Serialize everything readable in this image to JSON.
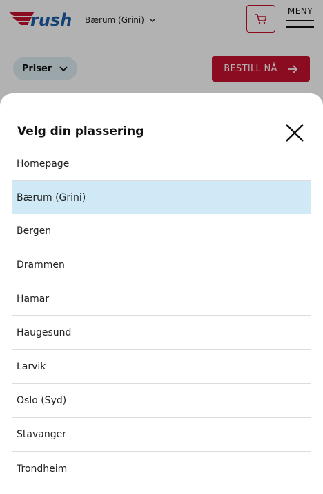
{
  "header": {
    "logo_text": "rush",
    "current_location": "Bærum (Grini)",
    "menu_label": "MENY"
  },
  "actions": {
    "prices_label": "Priser",
    "order_label": "BESTILL NÅ"
  },
  "location_picker": {
    "title": "Velg din plassering",
    "selected_index": 1,
    "items": [
      "Homepage",
      "Bærum (Grini)",
      "Bergen",
      "Drammen",
      "Hamar",
      "Haugesund",
      "Larvik",
      "Oslo (Syd)",
      "Stavanger",
      "Trondheim"
    ]
  },
  "colors": {
    "brand_red": "#c8102e",
    "brand_blue": "#1f5fa8",
    "selected_row": "#cfeaf6",
    "prices_button_bg": "#dfeef4"
  }
}
